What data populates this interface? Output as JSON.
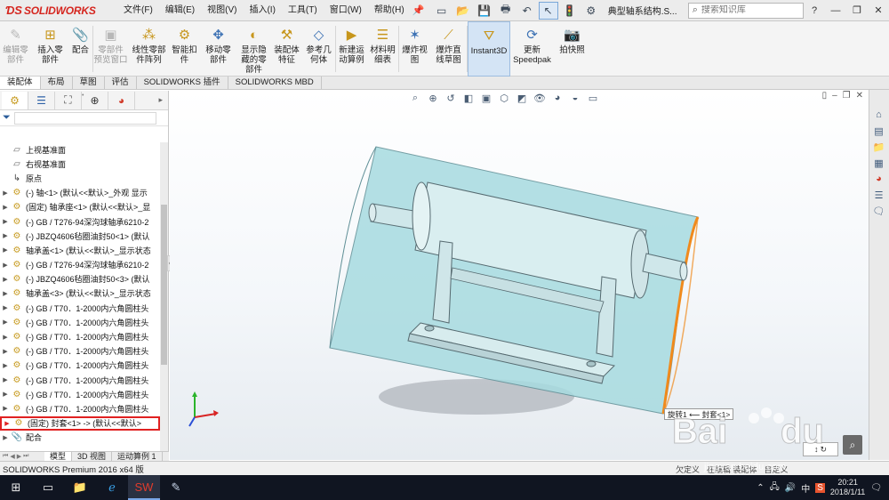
{
  "app": {
    "logo_ds": "𝔇𝔖",
    "logo_text": "SOLIDWORKS",
    "doc_title": "典型轴系结构.S...",
    "accent": "#d5261f"
  },
  "menu": [
    "文件(F)",
    "编辑(E)",
    "视图(V)",
    "插入(I)",
    "工具(T)",
    "窗口(W)",
    "帮助(H)"
  ],
  "search": {
    "placeholder": "搜索知识库"
  },
  "ribbon": [
    {
      "label": "编辑零\n部件",
      "icon": "edit-component-icon",
      "disabled": true
    },
    {
      "label": "插入零\n部件",
      "icon": "insert-component-icon",
      "disabled": false
    },
    {
      "label": "配合",
      "icon": "mate-icon",
      "disabled": false
    },
    {
      "label": "零部件\n预览窗口",
      "icon": "component-preview-icon",
      "disabled": true
    },
    {
      "label": "线性零部\n件阵列",
      "icon": "linear-pattern-icon",
      "disabled": false
    },
    {
      "label": "智能扣\n件",
      "icon": "smart-fastener-icon",
      "disabled": false
    },
    {
      "label": "移动零\n部件",
      "icon": "move-component-icon",
      "disabled": false
    },
    {
      "label": "显示隐\n藏的零\n部件",
      "icon": "show-hidden-icon",
      "disabled": false
    },
    {
      "label": "装配体\n特征",
      "icon": "assembly-feature-icon",
      "disabled": false
    },
    {
      "label": "参考几\n何体",
      "icon": "reference-geometry-icon",
      "disabled": false
    },
    {
      "label": "新建运\n动算例",
      "icon": "new-motion-study-icon",
      "disabled": false
    },
    {
      "label": "材料明\n细表",
      "icon": "bom-icon",
      "disabled": false
    },
    {
      "label": "爆炸视\n图",
      "icon": "exploded-view-icon",
      "disabled": false
    },
    {
      "label": "爆炸直\n线草图",
      "icon": "explode-line-sketch-icon",
      "disabled": false
    },
    {
      "label": "Instant3D",
      "icon": "instant3d-icon",
      "disabled": false,
      "active": true
    },
    {
      "label": "更新\nSpeedpak",
      "icon": "speedpak-icon",
      "disabled": false
    },
    {
      "label": "拍快照",
      "icon": "snapshot-icon",
      "disabled": false
    }
  ],
  "command_tabs": [
    "装配体",
    "布局",
    "草图",
    "评估",
    "SOLIDWORKS 插件",
    "SOLIDWORKS MBD"
  ],
  "tree": [
    {
      "label": "上视基准面",
      "icon": "plane",
      "expand": false
    },
    {
      "label": "右视基准面",
      "icon": "plane",
      "expand": false
    },
    {
      "label": "原点",
      "icon": "origin",
      "expand": false
    },
    {
      "label": "(-) 轴<1> (默认<<默认>_外观 显示",
      "icon": "part",
      "expand": true
    },
    {
      "label": "(固定) 轴承座<1> (默认<<默认>_显",
      "icon": "part",
      "expand": true
    },
    {
      "label": "(-) GB / T276-94深沟球轴承6210-2",
      "icon": "part",
      "expand": true
    },
    {
      "label": "(-) JBZQ4606毡圈油封50<1> (默认",
      "icon": "part",
      "expand": true
    },
    {
      "label": "轴承盖<1> (默认<<默认>_显示状态",
      "icon": "part",
      "expand": true
    },
    {
      "label": "(-) GB / T276-94深沟球轴承6210-2",
      "icon": "part",
      "expand": true
    },
    {
      "label": "(-) JBZQ4606毡圈油封50<3> (默认",
      "icon": "part",
      "expand": true
    },
    {
      "label": "轴承盖<3> (默认<<默认>_显示状态",
      "icon": "part",
      "expand": true
    },
    {
      "label": "(-) GB / T70．1-2000内六角圆柱头",
      "icon": "part",
      "expand": true
    },
    {
      "label": "(-) GB / T70．1-2000内六角圆柱头",
      "icon": "part",
      "expand": true
    },
    {
      "label": "(-) GB / T70．1-2000内六角圆柱头",
      "icon": "part",
      "expand": true
    },
    {
      "label": "(-) GB / T70．1-2000内六角圆柱头",
      "icon": "part",
      "expand": true
    },
    {
      "label": "(-) GB / T70．1-2000内六角圆柱头",
      "icon": "part",
      "expand": true
    },
    {
      "label": "(-) GB / T70．1-2000内六角圆柱头",
      "icon": "part",
      "expand": true
    },
    {
      "label": "(-) GB / T70．1-2000内六角圆柱头",
      "icon": "part",
      "expand": true
    },
    {
      "label": "(-) GB / T70．1-2000内六角圆柱头",
      "icon": "part",
      "expand": true
    },
    {
      "label": "(固定) 封套<1> -> (默认<<默认>",
      "icon": "part",
      "expand": true,
      "selected": true
    },
    {
      "label": "配合",
      "icon": "mate",
      "expand": true
    }
  ],
  "viewport": {
    "tooltip": "旋转1 ⟵ 封套<1>",
    "envelope_color": "#9fd6dc",
    "edge_highlight": "#f08a1c"
  },
  "bottom_tabs": [
    "模型",
    "3D 视图",
    "运动算例 1"
  ],
  "status": {
    "left": "SOLIDWORKS Premium 2016 x64 版",
    "right_1": "欠定义",
    "right_2": "在编辑 装配体",
    "right_3": "自定义"
  },
  "taskbar": {
    "time": "20:21",
    "date": "2018/1/11",
    "ime": "中"
  },
  "watermark": {
    "brand": "Baidu 经验",
    "url": "jingyan.baidu.com"
  }
}
